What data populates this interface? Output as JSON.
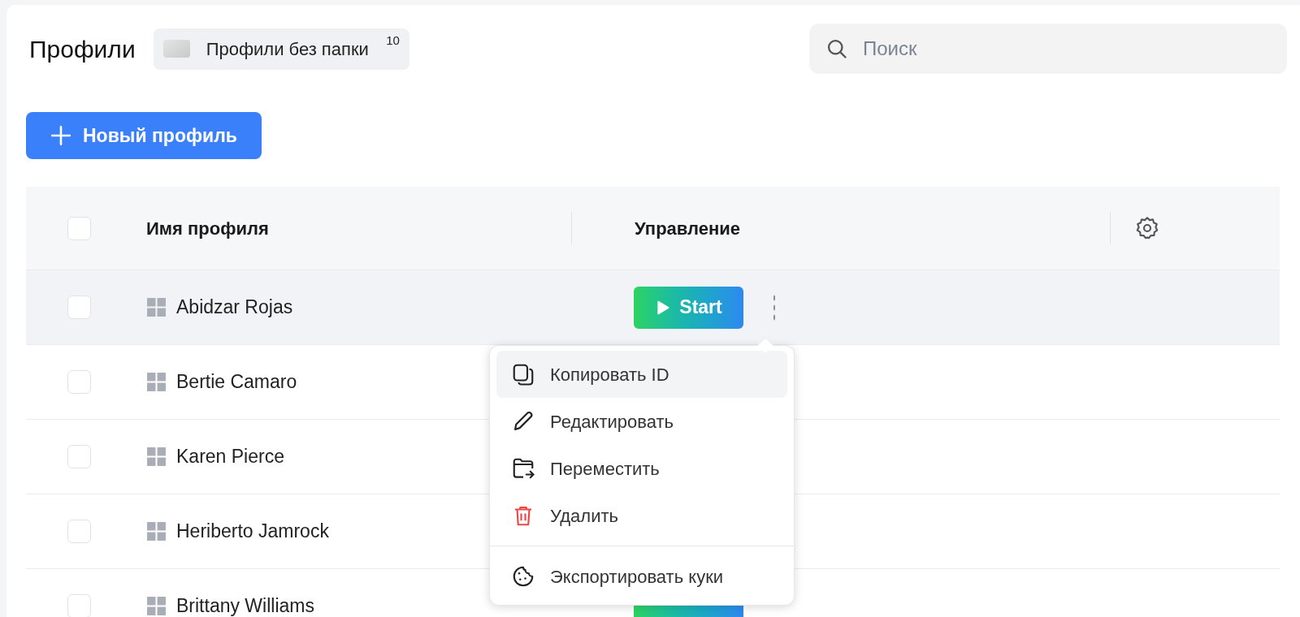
{
  "header": {
    "title": "Профили",
    "folder_chip": {
      "label": "Профили без папки",
      "count": "10"
    },
    "search": {
      "placeholder": "Поиск"
    }
  },
  "new_profile_button": {
    "label": "Новый профиль"
  },
  "table": {
    "header_checkbox": {
      "checked": false
    },
    "columns": [
      "Имя профиля",
      "Управление"
    ],
    "rows": [
      {
        "name": "Abidzar Rojas",
        "checked": false,
        "hovered": true,
        "start_shown": true,
        "start_label": "Start"
      },
      {
        "name": "Bertie Camaro",
        "checked": false,
        "hovered": false,
        "start_shown": false
      },
      {
        "name": "Karen Pierce",
        "checked": false,
        "hovered": false,
        "start_shown": false
      },
      {
        "name": "Heriberto Jamrock",
        "checked": false,
        "hovered": false,
        "start_shown": false
      },
      {
        "name": "Brittany Williams",
        "checked": false,
        "hovered": false,
        "start_shown": true
      }
    ]
  },
  "context_menu": {
    "groups": [
      [
        {
          "label": "Копировать ID",
          "kind": "copy",
          "selected": true
        },
        {
          "label": "Редактировать",
          "kind": "edit",
          "selected": false
        },
        {
          "label": "Переместить",
          "kind": "move",
          "selected": false
        },
        {
          "label": "Удалить",
          "kind": "delete",
          "selected": false
        }
      ],
      [
        {
          "label": "Экспортировать куки",
          "kind": "cookie",
          "selected": false
        }
      ]
    ]
  }
}
